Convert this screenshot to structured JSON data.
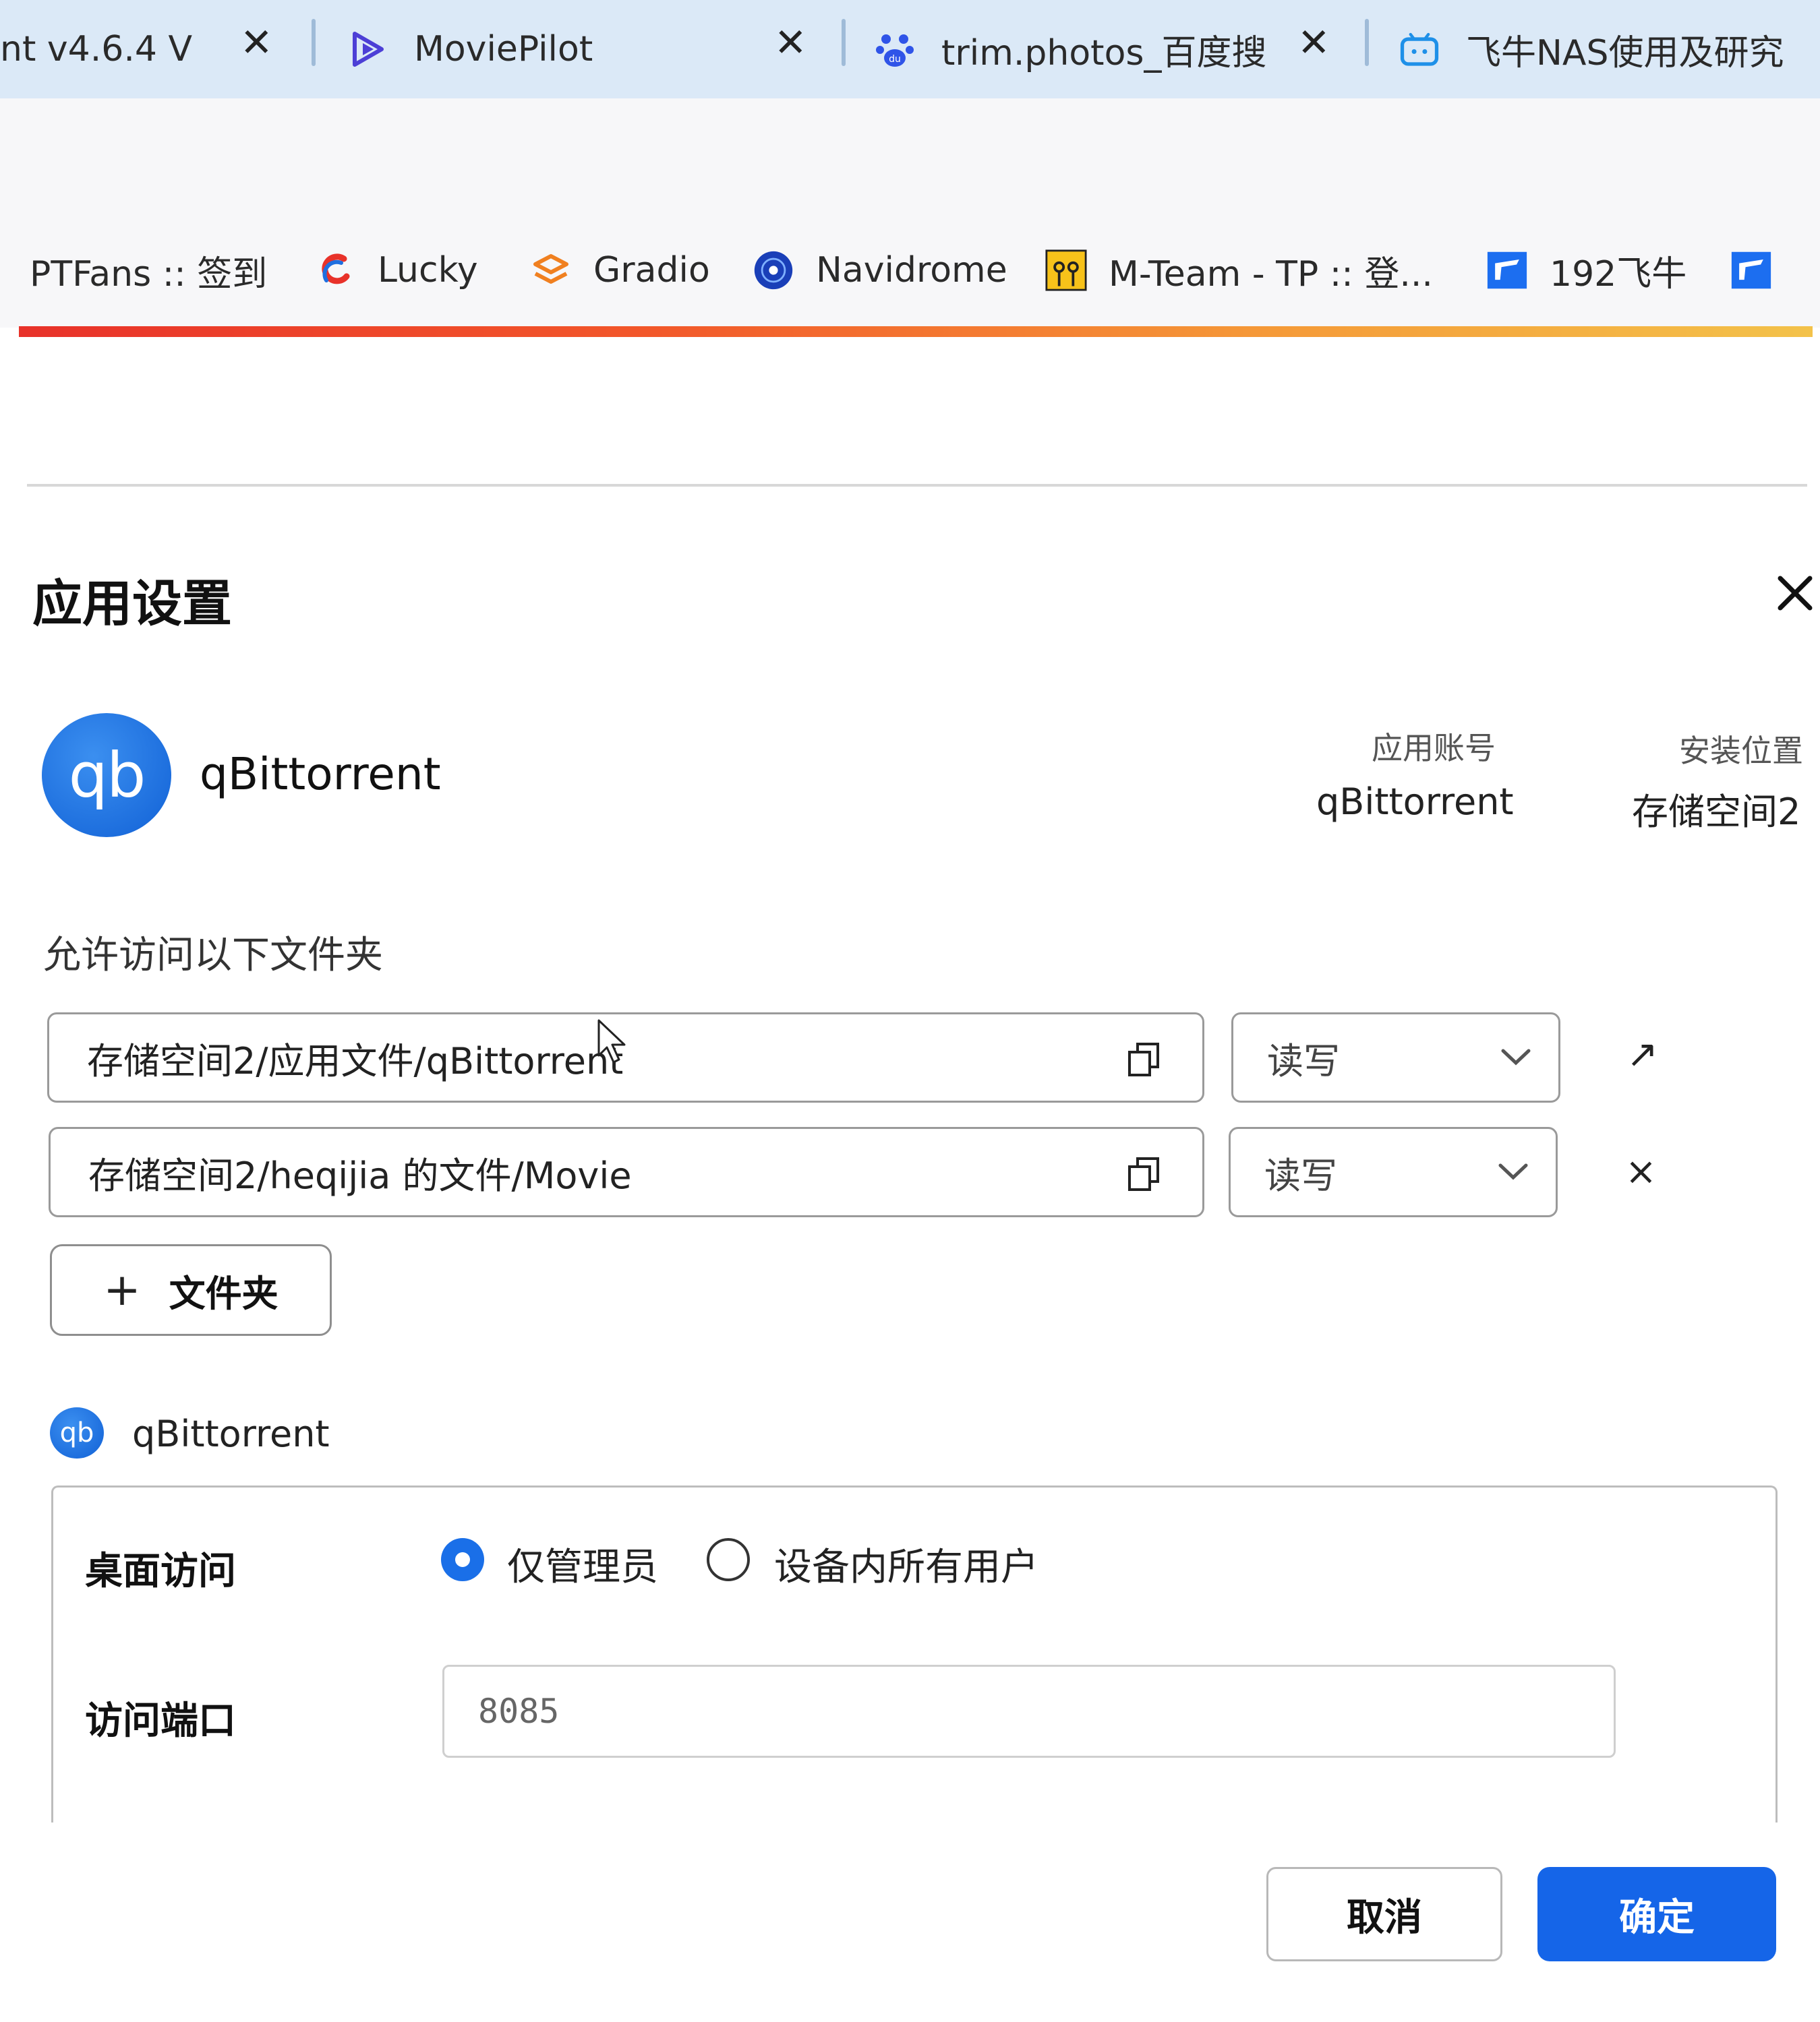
{
  "tabs": [
    {
      "title": "nt v4.6.4 V",
      "icon": "document-icon"
    },
    {
      "title": "MoviePilot",
      "icon": "moviepilot-icon"
    },
    {
      "title": "trim.photos_百度搜",
      "icon": "baidu-paw-icon"
    },
    {
      "title": "飞牛NAS使用及研究",
      "icon": "bilibili-tv-icon"
    }
  ],
  "bookmarks": [
    {
      "label": "PTFans :: 签到",
      "icon": "none"
    },
    {
      "label": "Lucky",
      "icon": "lucky-logo-icon"
    },
    {
      "label": "Gradio",
      "icon": "gradio-logo-icon"
    },
    {
      "label": "Navidrome",
      "icon": "navidrome-disc-icon"
    },
    {
      "label": "M-Team - TP :: 登...",
      "icon": "mteam-logo-icon"
    },
    {
      "label": "192飞牛",
      "icon": "fnos-logo-icon"
    },
    {
      "label": "",
      "icon": "fnos-logo-icon"
    }
  ],
  "dialog": {
    "title": "应用设置",
    "app_logo_text": "qb",
    "app_name": "qBittorrent",
    "account_label": "应用账号",
    "account_value": "qBittorrent",
    "install_label": "安装位置",
    "install_value": "存储空间2",
    "folders_label": "允许访问以下文件夹",
    "folders": [
      {
        "path": "存储空间2/应用文件/qBittorrent",
        "permission": "读写",
        "action": "↗"
      },
      {
        "path": "存储空间2/heqijia 的文件/Movie",
        "permission": "读写",
        "action": "×"
      }
    ],
    "add_folder_label": "文件夹",
    "sub_app_name": "qBittorrent",
    "desktop_access_label": "桌面访问",
    "desktop_options": [
      "仅管理员",
      "设备内所有用户"
    ],
    "desktop_selected": "仅管理员",
    "port_label": "访问端口",
    "port_value": "8085",
    "cancel_label": "取消",
    "confirm_label": "确定"
  },
  "colors": {
    "accent_blue": "#1565e8",
    "tab_strip": "#dbe9f7",
    "bookmark_bar": "#f7f7f9",
    "accent_bar_start": "#e8322a",
    "accent_bar_end": "#f3c24a"
  }
}
